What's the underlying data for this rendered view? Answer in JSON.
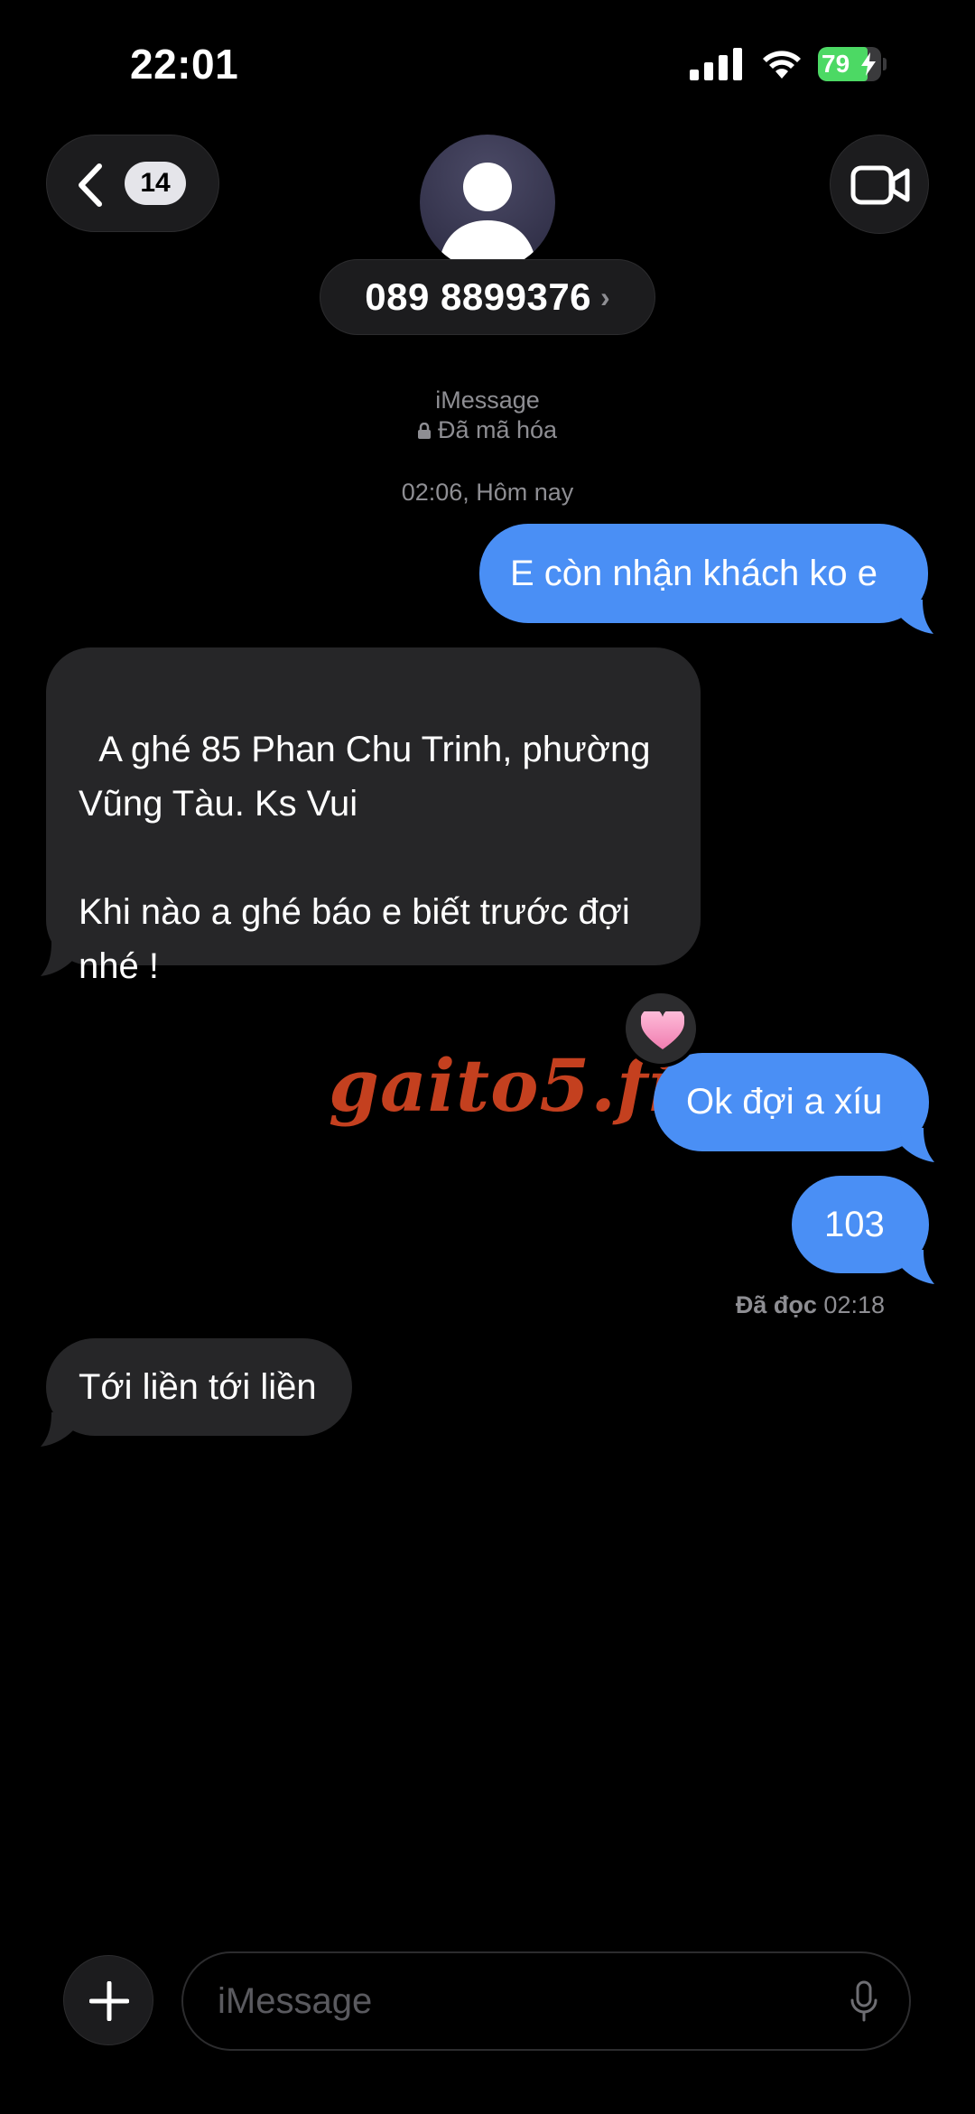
{
  "status_bar": {
    "time": "22:01",
    "battery_percent": "79",
    "battery_level": 0.79,
    "icons": [
      "signal-icon",
      "wifi-icon",
      "battery-charging-icon"
    ]
  },
  "header": {
    "back_badge": "14",
    "contact_name": "089 8899376",
    "contact_chevron": "›",
    "icons": [
      "back-chevron-icon",
      "person-avatar-icon",
      "video-camera-icon"
    ]
  },
  "conversation": {
    "service": "iMessage",
    "encryption": "Đã mã hóa",
    "timestamp": "02:06, Hôm nay",
    "messages": [
      {
        "direction": "sent",
        "text": "E còn nhận khách ko e"
      },
      {
        "direction": "received",
        "text": "A ghé 85 Phan Chu Trinh, phường Vũng Tàu. Ks Vui\n\nKhi nào a ghé báo e biết trước đợi nhé !"
      },
      {
        "direction": "sent",
        "text": "Ok đợi a xíu",
        "reaction": "heart"
      },
      {
        "direction": "sent",
        "text": "103"
      },
      {
        "direction": "received",
        "text": "Tới liền tới liền"
      }
    ],
    "read_receipt_label": "Đã đọc",
    "read_receipt_time": "02:18",
    "watermark": "gaito5.fit"
  },
  "composer": {
    "placeholder": "iMessage",
    "icons": [
      "plus-icon",
      "microphone-icon"
    ]
  },
  "colors": {
    "sent_bubble": "#4a8ff5",
    "received_bubble": "#262628",
    "watermark": "#c4401f",
    "reaction_heart": "#f7a1c4"
  }
}
